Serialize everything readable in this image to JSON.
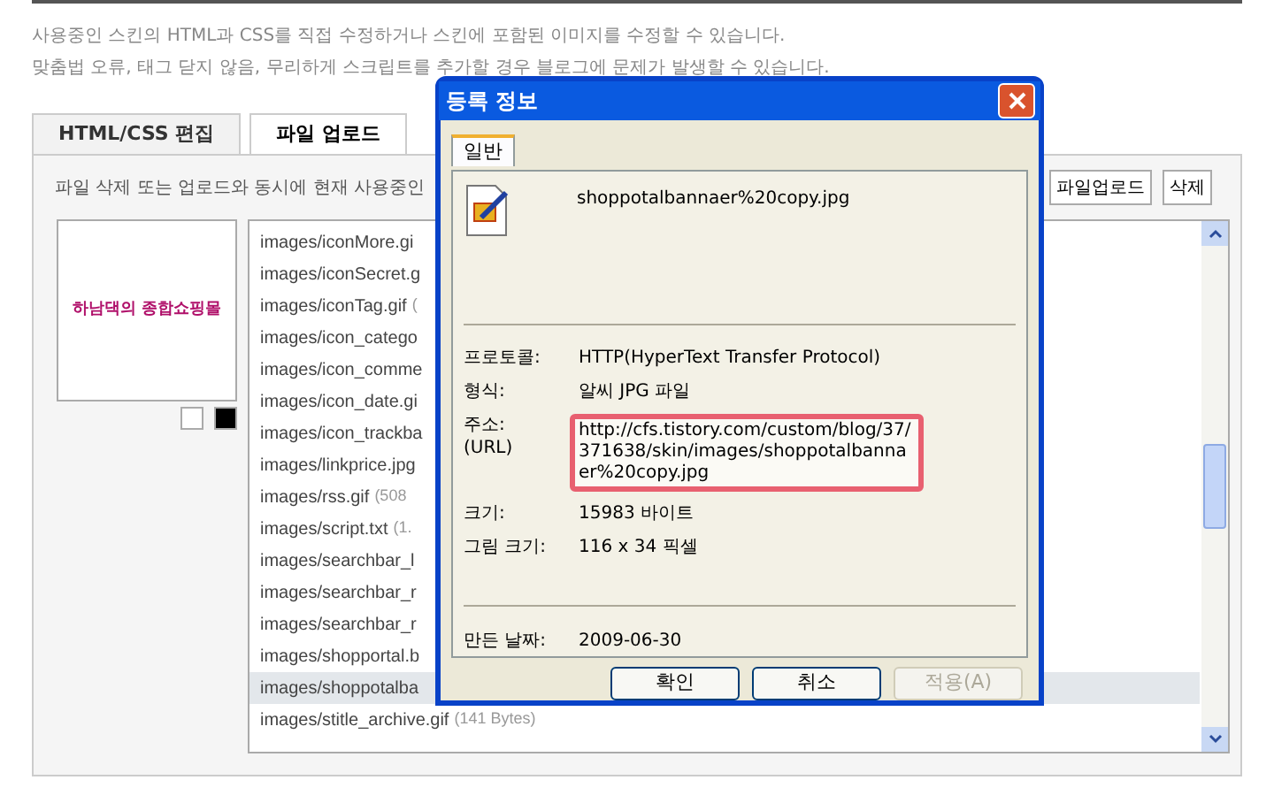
{
  "intro": [
    "사용중인 스킨의 HTML과 CSS를 직접 수정하거나 스킨에 포함된 이미지를 수정할 수 있습니다.",
    "맞춤법 오류, 태그 닫지 않음, 무리하게 스크립트를 추가할 경우 블로그에 문제가 발생할 수 있습니다."
  ],
  "tabs": [
    {
      "label": "HTML/CSS 편집",
      "selected": false
    },
    {
      "label": "파일 업로드",
      "selected": true
    }
  ],
  "panel": {
    "description": "파일 삭제 또는 업로드와 동시에 현재 사용중인",
    "buttons": [
      "파일업로드",
      "삭제"
    ],
    "preview": {
      "text": "하남댁의 종합쇼핑몰",
      "swatches": [
        {
          "color": "#ffffff"
        },
        {
          "color": "#000000"
        }
      ]
    },
    "files": [
      {
        "name": "images/iconMore.gi",
        "selected": false
      },
      {
        "name": "images/iconSecret.g",
        "selected": false
      },
      {
        "name": "images/iconTag.gif",
        "size": "(",
        "selected": false
      },
      {
        "name": "images/icon_catego",
        "selected": false
      },
      {
        "name": "images/icon_comme",
        "selected": false
      },
      {
        "name": "images/icon_date.gi",
        "selected": false
      },
      {
        "name": "images/icon_trackba",
        "selected": false
      },
      {
        "name": "images/linkprice.jpg",
        "selected": false
      },
      {
        "name": "images/rss.gif",
        "size": "(508",
        "selected": false
      },
      {
        "name": "images/script.txt",
        "size": "(1.",
        "selected": false
      },
      {
        "name": "images/searchbar_l",
        "selected": false
      },
      {
        "name": "images/searchbar_r",
        "selected": false
      },
      {
        "name": "images/searchbar_r",
        "selected": false
      },
      {
        "name": "images/shopportal.b",
        "selected": false
      },
      {
        "name": "images/shoppotalba",
        "selected": true
      },
      {
        "name": "images/stitle_archive.gif",
        "size": "(141 Bytes)",
        "selected": false
      }
    ]
  },
  "dialog": {
    "title": "등록 정보",
    "tab": {
      "label": "일반",
      "selected": true
    },
    "filename": "shoppotalbannaer%20copy.jpg",
    "properties": [
      {
        "label": "프로토콜:",
        "value": "HTTP(HyperText Transfer Protocol)"
      },
      {
        "label": "형식:",
        "value": "알씨 JPG 파일"
      },
      {
        "label": "주소:\n(URL)",
        "value": "http://cfs.tistory.com/custom/blog/37/371638/skin/images/shoppotalbannaer%20copy.jpg",
        "highlighted": true
      },
      {
        "label": "크기:",
        "value": "15983 바이트"
      },
      {
        "label": "그림 크기:",
        "value": "116  x  34  픽셀"
      }
    ],
    "created": {
      "label": "만든 날짜:",
      "value": "2009-06-30"
    },
    "buttons": [
      {
        "label": "확인",
        "disabled": false
      },
      {
        "label": "취소",
        "disabled": false
      },
      {
        "label": "적용(A)",
        "disabled": true
      }
    ]
  }
}
